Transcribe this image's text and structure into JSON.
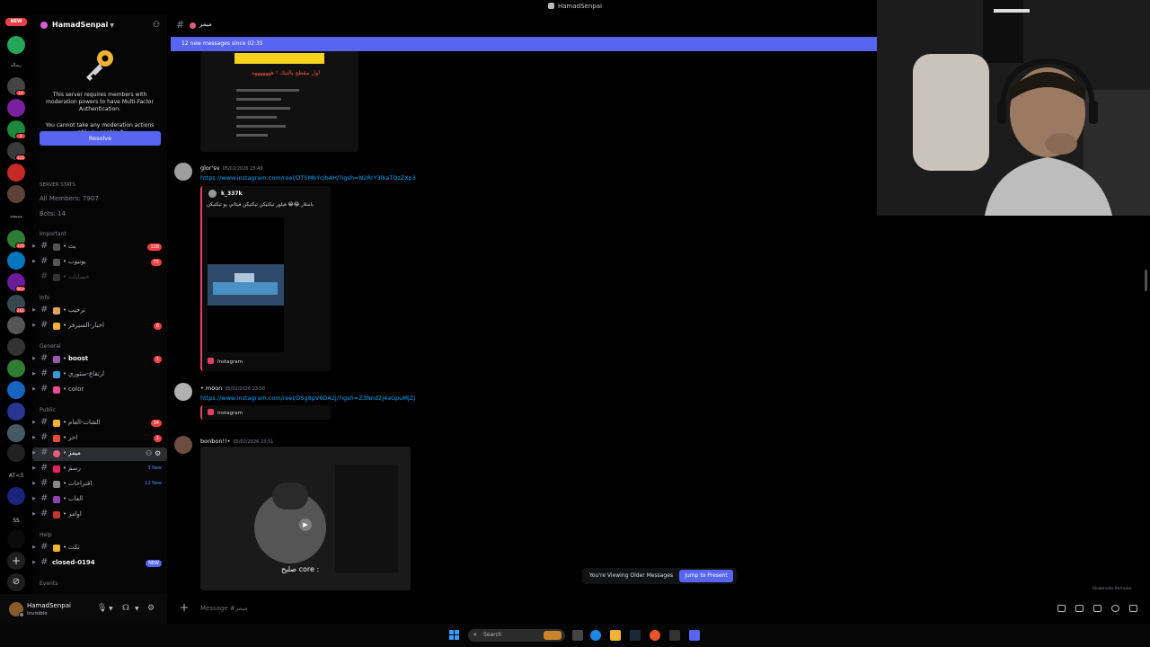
{
  "window": {
    "title": "HamadSenpai"
  },
  "rail": {
    "new_badge": "NEW",
    "labels": [
      "رسالة",
      "مينيشة",
      "AT<3",
      "SS"
    ],
    "badges": [
      "14",
      "4",
      "1",
      "321",
      "2",
      "3",
      "325",
      "9",
      "5K+",
      "261",
      "1"
    ]
  },
  "server": {
    "name": "HamadSenpai"
  },
  "mfa": {
    "line1": "This server requires members with moderation powers to have Multi-Factor Authentication.",
    "line2": "You cannot take any moderation actions until you enable it.",
    "resolve": "Resolve"
  },
  "stats": {
    "header": "SERVER STATS",
    "members": "All Members: 7907",
    "bots": "Bots: 14"
  },
  "categories": {
    "important": "Important",
    "info": "Info",
    "general": "General",
    "public": "Public",
    "help": "Help",
    "events": "Events"
  },
  "channels": {
    "important": [
      {
        "name": "بث",
        "badge": "128"
      },
      {
        "name": "يوتيوب",
        "badge": "75"
      },
      {
        "name": "حسابات",
        "badge": ""
      }
    ],
    "info": [
      {
        "name": "ترحيب",
        "badge": ""
      },
      {
        "name": "اخبار-السيرفر",
        "badge": "6"
      }
    ],
    "general": [
      {
        "name": "boost",
        "badge": "1"
      },
      {
        "name": "ارتقاع-ستوري",
        "badge": ""
      },
      {
        "name": "color",
        "badge": ""
      }
    ],
    "public": [
      {
        "name": "الشات-العام",
        "badge": "34"
      },
      {
        "name": "اخر",
        "badge": "1"
      },
      {
        "name": "ميمز",
        "badge": ""
      },
      {
        "name": "رسم",
        "badge": "3 New"
      },
      {
        "name": "اقتراحات",
        "badge": "12 New"
      },
      {
        "name": "العاب",
        "badge": ""
      },
      {
        "name": "اوامر",
        "badge": ""
      }
    ],
    "help": [
      {
        "name": "تكت",
        "badge": ""
      },
      {
        "name": "closed-0194",
        "badge": "NEW"
      }
    ]
  },
  "user": {
    "name": "HamadSenpai",
    "status": "Invisible"
  },
  "chat": {
    "channel_name": "ميمز",
    "new_messages": "12 new messages since 02:35",
    "messages": [
      {
        "author": "glor'sv",
        "timestamp": "05/02/2026 23:49",
        "link": "https://www.instagram.com/reel/DTSMbYcjbAH/?igsh=N2RrY3lkaTQzZXp3",
        "embed_user": "k_337k",
        "embed_caption": "باسلار 😂😂 فيلور تيكتيكن تيكتيكن فيتاتي يو تيكتيكن",
        "embed_provider": "Instagram"
      },
      {
        "author": "• moon",
        "timestamp": "05/02/2026 23:50",
        "link": "https://www.instagram.com/reel/DSg8pV6DA2j/?igsh=Z3Nnd2J4aGpuMjZj",
        "embed_provider": "Instagram"
      },
      {
        "author": "bonbon!!•",
        "timestamp": "05/02/2026 23:51",
        "video_caption": "صليح core :"
      }
    ],
    "video_title_top": "اول مقطع بالتيك ! هههههههه",
    "older_notice": "You're Viewing Older Messages",
    "jump_button": "Jump to Present",
    "slowmode": "Slowmode Immune",
    "composer_placeholder": "Message #ميمز"
  },
  "taskbar": {
    "search": "Search"
  }
}
